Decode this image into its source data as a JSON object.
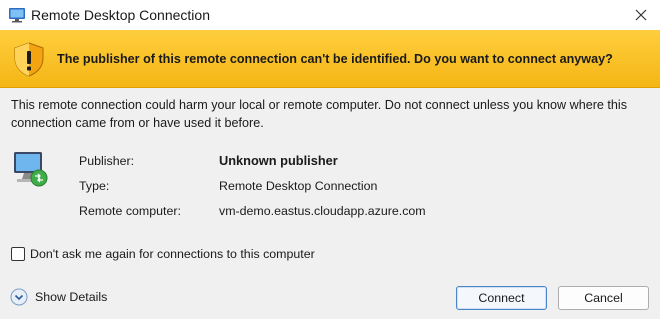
{
  "window": {
    "title": "Remote Desktop Connection",
    "icon": "remote-desktop-icon",
    "close_icon": "close-icon"
  },
  "warning": {
    "icon": "warning-shield-icon",
    "message": "The publisher of this remote connection can't be identified. Do you want to connect anyway?",
    "background": "#f8c12b"
  },
  "description": "This remote connection could harm your local or remote computer. Do not connect unless you know where this connection came from or have used it before.",
  "details": {
    "icon": "computer-connection-icon",
    "fields": [
      {
        "label": "Publisher:",
        "value": "Unknown publisher",
        "bold": true
      },
      {
        "label": "Type:",
        "value": "Remote Desktop Connection"
      },
      {
        "label": "Remote computer:",
        "value": "vm-demo.eastus.cloudapp.azure.com"
      }
    ]
  },
  "checkbox": {
    "label": "Don't ask me again for connections to this computer",
    "checked": false
  },
  "footer": {
    "show_details_label": "Show Details",
    "show_details_icon": "chevron-down-circle-icon",
    "connect_label": "Connect",
    "cancel_label": "Cancel",
    "accent": "#4a86c8"
  }
}
